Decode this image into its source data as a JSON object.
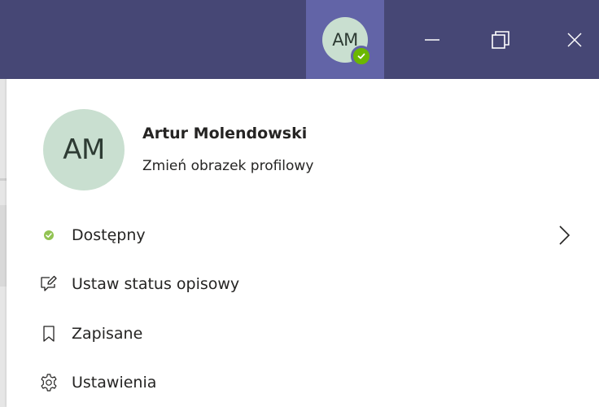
{
  "titlebar": {
    "avatar_initials": "AM",
    "presence": "available",
    "controls": {
      "minimize_icon": "minimize-icon",
      "maximize_icon": "restore-icon",
      "close_icon": "close-icon"
    }
  },
  "profile": {
    "initials": "AM",
    "name": "Artur Molendowski",
    "change_picture": "Zmień obrazek profilowy"
  },
  "menu": {
    "status": {
      "label": "Dostępny",
      "icon": "available-dot-icon",
      "has_submenu": true
    },
    "status_message": {
      "label": "Ustaw status opisowy",
      "icon": "edit-message-icon"
    },
    "saved": {
      "label": "Zapisane",
      "icon": "bookmark-icon"
    },
    "settings": {
      "label": "Ustawienia",
      "icon": "gear-icon"
    }
  },
  "colors": {
    "titlebar": "#464775",
    "avatar_button_active": "#6264a7",
    "avatar_bg": "#c9dfd0",
    "presence_available": "#6bb700",
    "text": "#252423"
  }
}
